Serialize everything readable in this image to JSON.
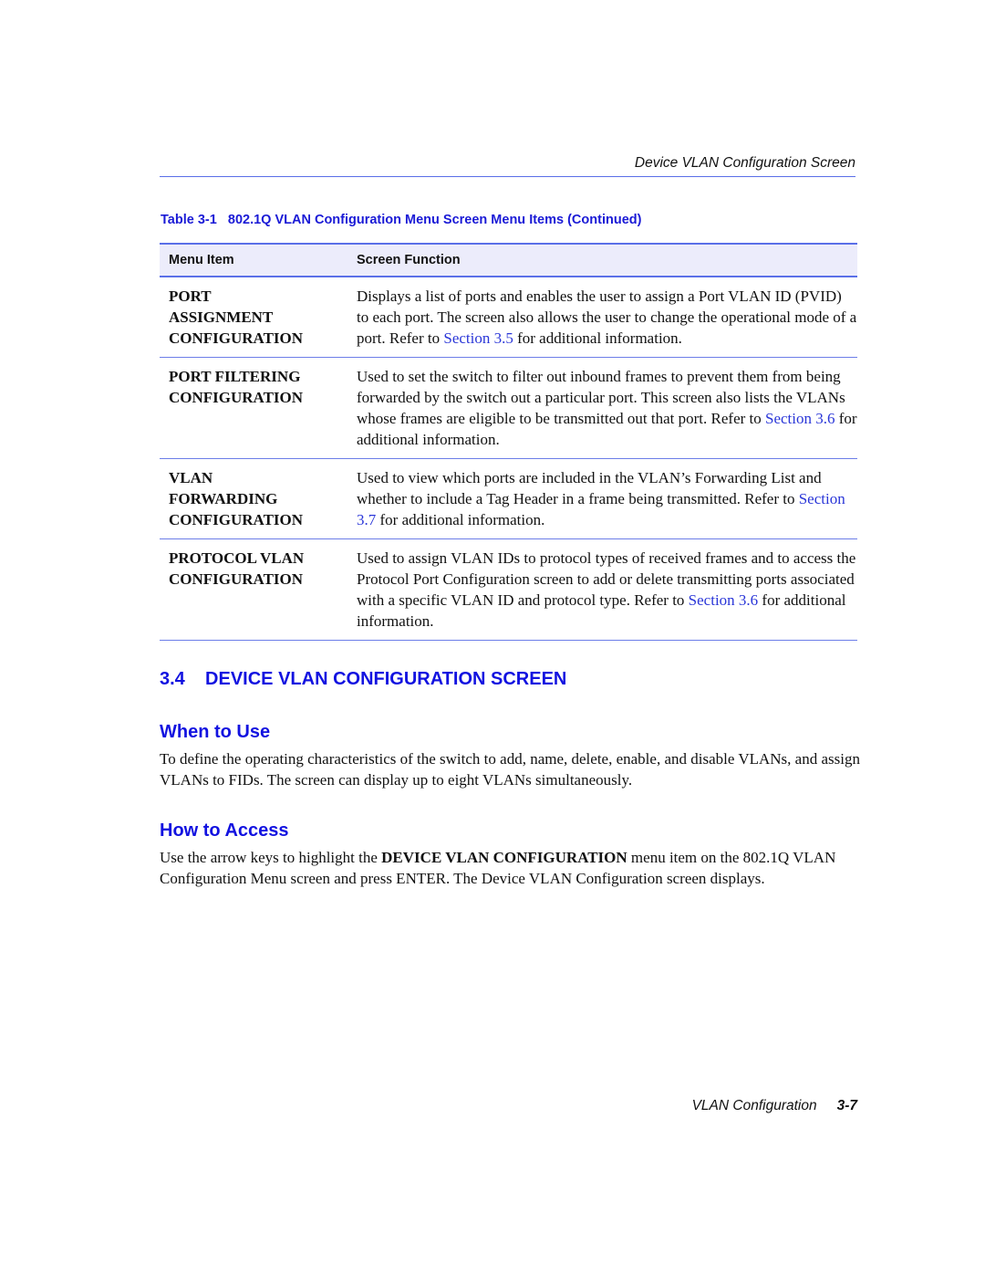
{
  "running_header": "Device VLAN Configuration Screen",
  "table": {
    "caption_label": "Table 3-1",
    "caption_title": "802.1Q VLAN Configuration Menu Screen Menu Items (Continued)",
    "headers": [
      "Menu Item",
      "Screen Function"
    ],
    "rows": [
      {
        "item_lines": [
          "PORT",
          "ASSIGNMENT",
          "CONFIGURATION"
        ],
        "desc_before": "Displays a list of ports and enables the user to assign a Port VLAN ID (PVID) to each port. The screen also allows the user to change the operational mode of a port. Refer to ",
        "link": "Section 3.5",
        "desc_after": " for additional information."
      },
      {
        "item_lines": [
          "PORT FILTERING",
          "CONFIGURATION"
        ],
        "desc_before": "Used to set the switch to filter out inbound frames to prevent them from being forwarded by the switch out a particular port. This screen also lists the VLANs whose frames are eligible to be transmitted out that port. Refer to ",
        "link": "Section 3.6",
        "desc_after": " for additional information."
      },
      {
        "item_lines": [
          "VLAN",
          "FORWARDING",
          "CONFIGURATION"
        ],
        "desc_before": "Used to view which ports are included in the VLAN’s Forwarding List and whether to include a Tag Header in a frame being transmitted. Refer to ",
        "link": "Section 3.7",
        "desc_after": " for additional information."
      },
      {
        "item_lines": [
          "PROTOCOL VLAN",
          "CONFIGURATION"
        ],
        "desc_before": "Used to assign VLAN IDs to protocol types of received frames and to access the Protocol Port Configuration screen to add or delete transmitting ports associated with a specific VLAN ID and protocol type. Refer to ",
        "link": "Section 3.6",
        "desc_after": " for additional information."
      }
    ]
  },
  "section": {
    "number": "3.4",
    "title": "DEVICE VLAN CONFIGURATION SCREEN"
  },
  "when_to_use": {
    "heading": "When to Use",
    "text": "To define the operating characteristics of the switch to add, name, delete, enable, and disable VLANs, and assign VLANs to FIDs. The screen can display up to eight VLANs simultaneously."
  },
  "how_to_access": {
    "heading": "How to Access",
    "text_before": "Use the arrow keys to highlight the ",
    "bold": "DEVICE VLAN CONFIGURATION",
    "text_after": " menu item on the 802.1Q VLAN Configuration Menu screen and press ENTER. The Device VLAN Configuration screen displays."
  },
  "footer": {
    "title": "VLAN Configuration",
    "page": "3-7"
  },
  "colors": {
    "heading_blue": "#1212e0",
    "link_blue": "#2a36d8",
    "rule_blue": "#5a6fe8",
    "header_fill": "#ececfb"
  }
}
